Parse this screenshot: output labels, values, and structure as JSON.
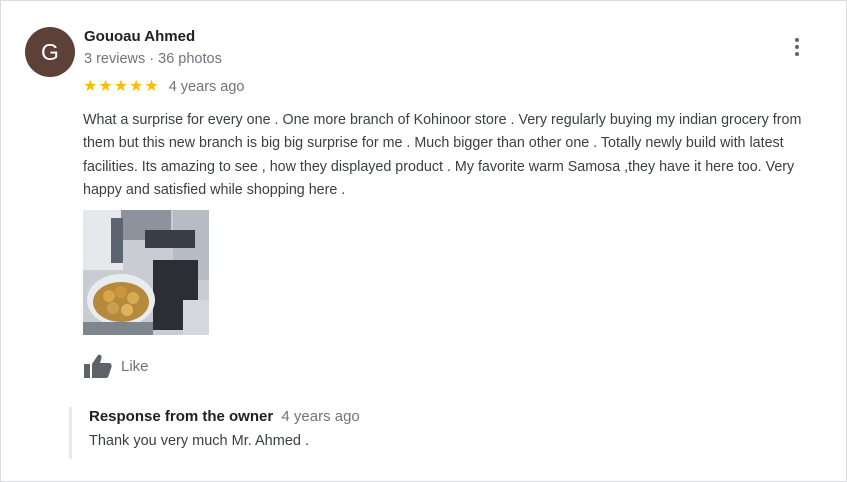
{
  "review": {
    "avatar_initial": "G",
    "author_name": "Gouoau Ahmed",
    "author_meta": "3 reviews · 36 photos",
    "rating": 5,
    "rating_max": 5,
    "time": "4 years ago",
    "text": "What a surprise for every one . One more branch of Kohinoor store . Very regularly buying my indian grocery from them but this new branch is big big surprise for me . Much bigger than other one . Totally newly build with latest facilities.  Its amazing to see , how they displayed product . My favorite warm Samosa ,they have it here too. Very happy and satisfied while shopping here .",
    "photo_icon": "review-photo-samosa",
    "like_label": "Like",
    "more_icon": "more-vert-icon"
  },
  "owner_response": {
    "label": "Response from the owner",
    "time": "4 years ago",
    "text": "Thank you very much Mr. Ahmed ."
  },
  "colors": {
    "avatar_bg": "#5d4037",
    "star": "#fbbc04",
    "muted_text": "#70757a",
    "body_text": "#3c4043",
    "title_text": "#202124"
  }
}
